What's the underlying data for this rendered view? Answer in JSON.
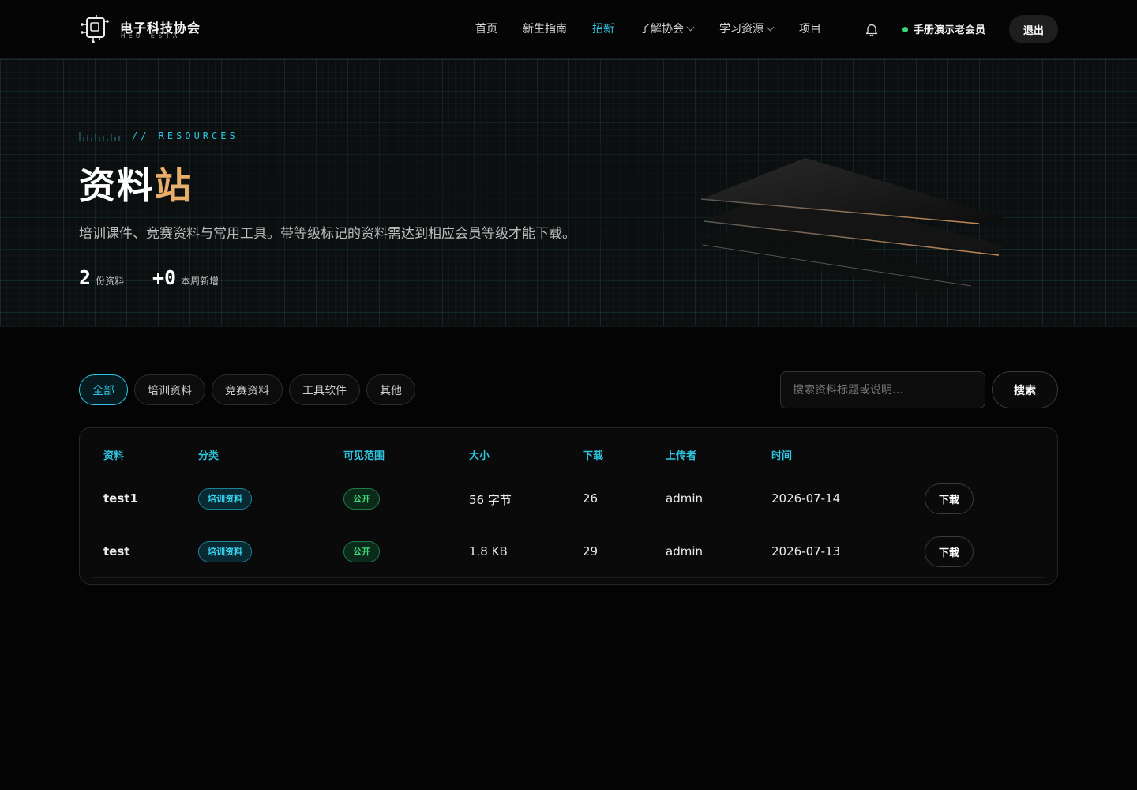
{
  "header": {
    "logo_cn": "电子科技协会",
    "logo_en": "HEU ESTA",
    "nav": [
      "首页",
      "新生指南",
      "招新",
      "了解协会",
      "学习资源",
      "项目"
    ],
    "active_nav": "招新",
    "user_name": "手册演示老会员",
    "logout_label": "退出"
  },
  "hero": {
    "eyebrow": "// RESOURCES",
    "title_main": "资料",
    "title_accent": "站",
    "subtitle": "培训课件、竞赛资料与常用工具。带等级标记的资料需达到相应会员等级才能下载。",
    "stats": [
      {
        "num": "2",
        "label": "份资料"
      },
      {
        "num": "+0",
        "label": "本周新增"
      }
    ]
  },
  "filters": {
    "chips": [
      "全部",
      "培训资料",
      "竞赛资料",
      "工具软件",
      "其他"
    ],
    "active": "全部",
    "search_placeholder": "搜索资料标题或说明…",
    "search_label": "搜索"
  },
  "table": {
    "headers": [
      "资料",
      "分类",
      "可见范围",
      "大小",
      "下载",
      "上传者",
      "时间"
    ],
    "rows": [
      {
        "name": "test1",
        "category": "培训资料",
        "visibility": "公开",
        "size": "56 字节",
        "downloads": "26",
        "uploader": "admin",
        "date": "2026-07-14",
        "action": "下载"
      },
      {
        "name": "test",
        "category": "培训资料",
        "visibility": "公开",
        "size": "1.8 KB",
        "downloads": "29",
        "uploader": "admin",
        "date": "2026-07-13",
        "action": "下载"
      }
    ]
  },
  "colors": {
    "accent": "#2ec5e0",
    "title_accent": "#e8ae6a",
    "online": "#3ad57a",
    "public_tag": "#3fdc7c"
  }
}
